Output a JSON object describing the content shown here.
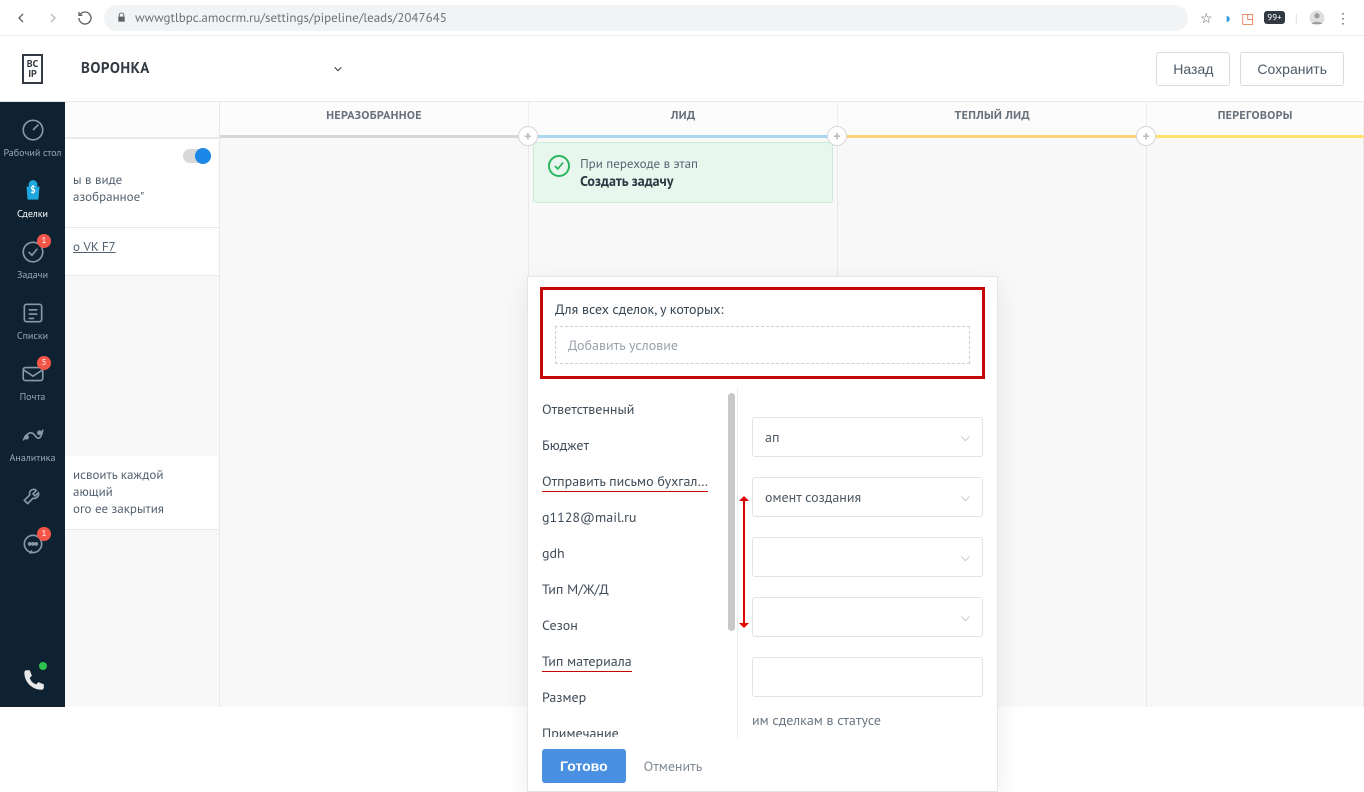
{
  "browser": {
    "url": "wwwgtlbpc.amocrm.ru/settings/pipeline/leads/2047645",
    "ext_badge": "99+"
  },
  "header": {
    "title": "ВОРОНКА",
    "back": "Назад",
    "save": "Сохранить"
  },
  "sidebar": {
    "items": [
      {
        "label": "Рабочий стол"
      },
      {
        "label": "Сделки"
      },
      {
        "label": "Задачи",
        "badge": "1"
      },
      {
        "label": "Списки"
      },
      {
        "label": "Почта",
        "badge": "5"
      },
      {
        "label": "Аналитика"
      }
    ]
  },
  "pipeline": {
    "stages": [
      {
        "label": "НЕРАЗОБРАННОЕ",
        "color": "#d6d6d6"
      },
      {
        "label": "ЛИД",
        "color": "#a9d7f0"
      },
      {
        "label": "ТЕПЛЫЙ ЛИД",
        "color": "#ffd37a"
      },
      {
        "label": "ПЕРЕГОВОРЫ",
        "color": "#ffe16b"
      }
    ]
  },
  "leftcol": {
    "card1_l1": "ы в виде",
    "card1_l2": "азобранное\"",
    "card2": "о VK F7",
    "card3_l1": "исвоить каждой",
    "card3_l2": "ающий",
    "card3_l3": "ого ее закрытия"
  },
  "trigger": {
    "line1": "При переходе в этап",
    "line2": "Создать задачу"
  },
  "panel": {
    "cond_title": "Для всех сделок, у которых:",
    "cond_placeholder": "Добавить условие",
    "options": [
      "Ответственный",
      "Бюджет",
      "Отправить письмо бухгал…",
      "g1128@mail.ru",
      "gdh",
      "Тип М/Ж/Д",
      "Сезон",
      "Тип материала",
      "Размер",
      "Примечание"
    ],
    "select1": "ап",
    "select2": "омент создания",
    "status_text": "им сделкам в статусе",
    "done": "Готово",
    "cancel": "Отменить"
  }
}
